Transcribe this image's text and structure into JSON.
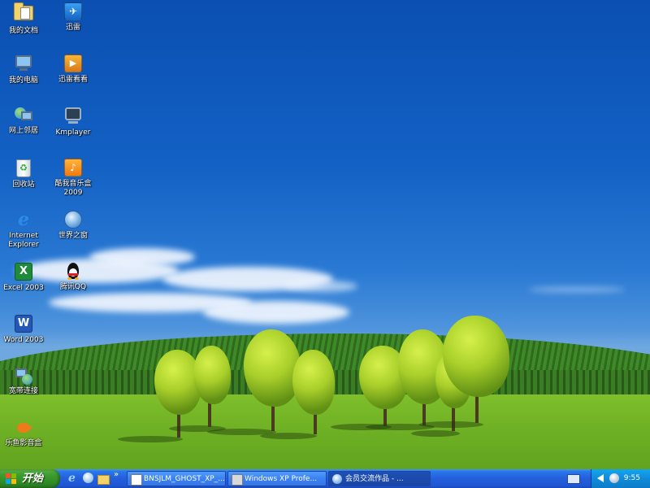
{
  "desktop_icons": [
    {
      "label": "我的文档",
      "icon": "my-documents-icon"
    },
    {
      "label": "我的电脑",
      "icon": "my-computer-icon"
    },
    {
      "label": "网上邻居",
      "icon": "network-places-icon"
    },
    {
      "label": "回收站",
      "icon": "recycle-bin-icon"
    },
    {
      "label": "Internet\nExplorer",
      "icon": "internet-explorer-icon"
    },
    {
      "label": "Excel 2003",
      "icon": "excel-icon"
    },
    {
      "label": "Word 2003",
      "icon": "word-icon"
    },
    {
      "label": "宽带连接",
      "icon": "broadband-connection-icon"
    },
    {
      "label": "乐鱼影音盒",
      "icon": "leyu-media-box-icon"
    },
    {
      "label": "迅雷",
      "icon": "xunlei-icon"
    },
    {
      "label": "迅雷看看",
      "icon": "xunlei-kankan-icon"
    },
    {
      "label": "Kmplayer",
      "icon": "kmplayer-icon"
    },
    {
      "label": "酷我音乐盒\n2009",
      "icon": "kuwo-music-box-icon"
    },
    {
      "label": "世界之窗",
      "icon": "theworld-browser-icon"
    },
    {
      "label": "腾讯QQ",
      "icon": "tencent-qq-icon"
    }
  ],
  "taskbar": {
    "start_label": "开始",
    "quick_launch_more": "»",
    "tasks": [
      {
        "label": "BNSJLM_GHOST_XP_..."
      },
      {
        "label": "Windows XP Profe..."
      },
      {
        "label": "会员交流作品 - ..."
      }
    ],
    "clock": "9:55"
  },
  "colors": {
    "taskbar_blue": "#245edb",
    "start_green": "#3c9d30",
    "tray_blue": "#0f8bd9",
    "sky": "#1361c4",
    "lawn": "#6eb024"
  }
}
